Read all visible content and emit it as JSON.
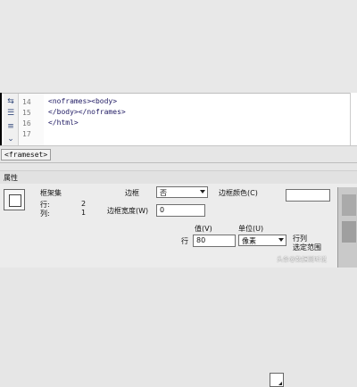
{
  "editor": {
    "line_numbers": [
      "14",
      "15",
      "16",
      "17"
    ],
    "code_lines": [
      "<noframes><body>",
      "</body></noframes>",
      "</html>",
      ""
    ]
  },
  "tagbar": {
    "tag": "<frameset>"
  },
  "properties": {
    "title": "属性",
    "name": "框架集",
    "rows_label": "行:",
    "rows_value": "2",
    "cols_label": "列:",
    "cols_value": "1",
    "border_label": "边框",
    "border_value": "否",
    "border_width_label": "边框宽度(W)",
    "border_width_value": "0",
    "border_color_label": "边框颜色(C)",
    "value_label": "值(V)",
    "unit_label": "单位(U)",
    "row_label": "行",
    "row_value": "80",
    "unit_value": "像素",
    "rowcol_label": "行列",
    "rowcol_selection": "选定范围"
  },
  "watermark": "头条@数据测听说"
}
